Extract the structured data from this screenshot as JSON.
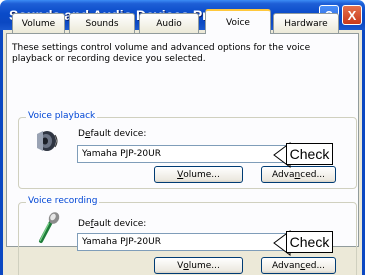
{
  "window": {
    "title": "Sounds and Audio Devices Properties",
    "help_label": "?",
    "close_label": "X"
  },
  "tabs": [
    {
      "label": "Volume",
      "active": false
    },
    {
      "label": "Sounds",
      "active": false
    },
    {
      "label": "Audio",
      "active": false
    },
    {
      "label": "Voice",
      "active": true
    },
    {
      "label": "Hardware",
      "active": false
    }
  ],
  "description": "These settings control volume and advanced options for the voice\nplayback or recording device you selected.",
  "playback": {
    "group_title": "Voice playback",
    "device_label_prefix": "D",
    "device_label_accel": "e",
    "device_label_rest": "fault device:",
    "device_value": "Yamaha PJP-20UR",
    "volume_prefix": "",
    "volume_accel": "V",
    "volume_rest": "olume...",
    "advanced_prefix": "Adva",
    "advanced_accel": "n",
    "advanced_rest": "ced...",
    "callout": "Check",
    "icon": "speaker-icon"
  },
  "recording": {
    "group_title": "Voice recording",
    "device_label_prefix": "De",
    "device_label_accel": "f",
    "device_label_rest": "ault device:",
    "device_value": "Yamaha PJP-20UR",
    "volume_prefix": "V",
    "volume_accel": "o",
    "volume_rest": "lume...",
    "advanced_prefix": "Advan",
    "advanced_accel": "c",
    "advanced_rest": "ed...",
    "callout": "Check",
    "icon": "microphone-icon"
  },
  "colors": {
    "titlebar": "#0b48c2",
    "group_title": "#0046d5",
    "dialog_face": "#ece9d8",
    "active_tab_highlight": "#ffc83c"
  }
}
